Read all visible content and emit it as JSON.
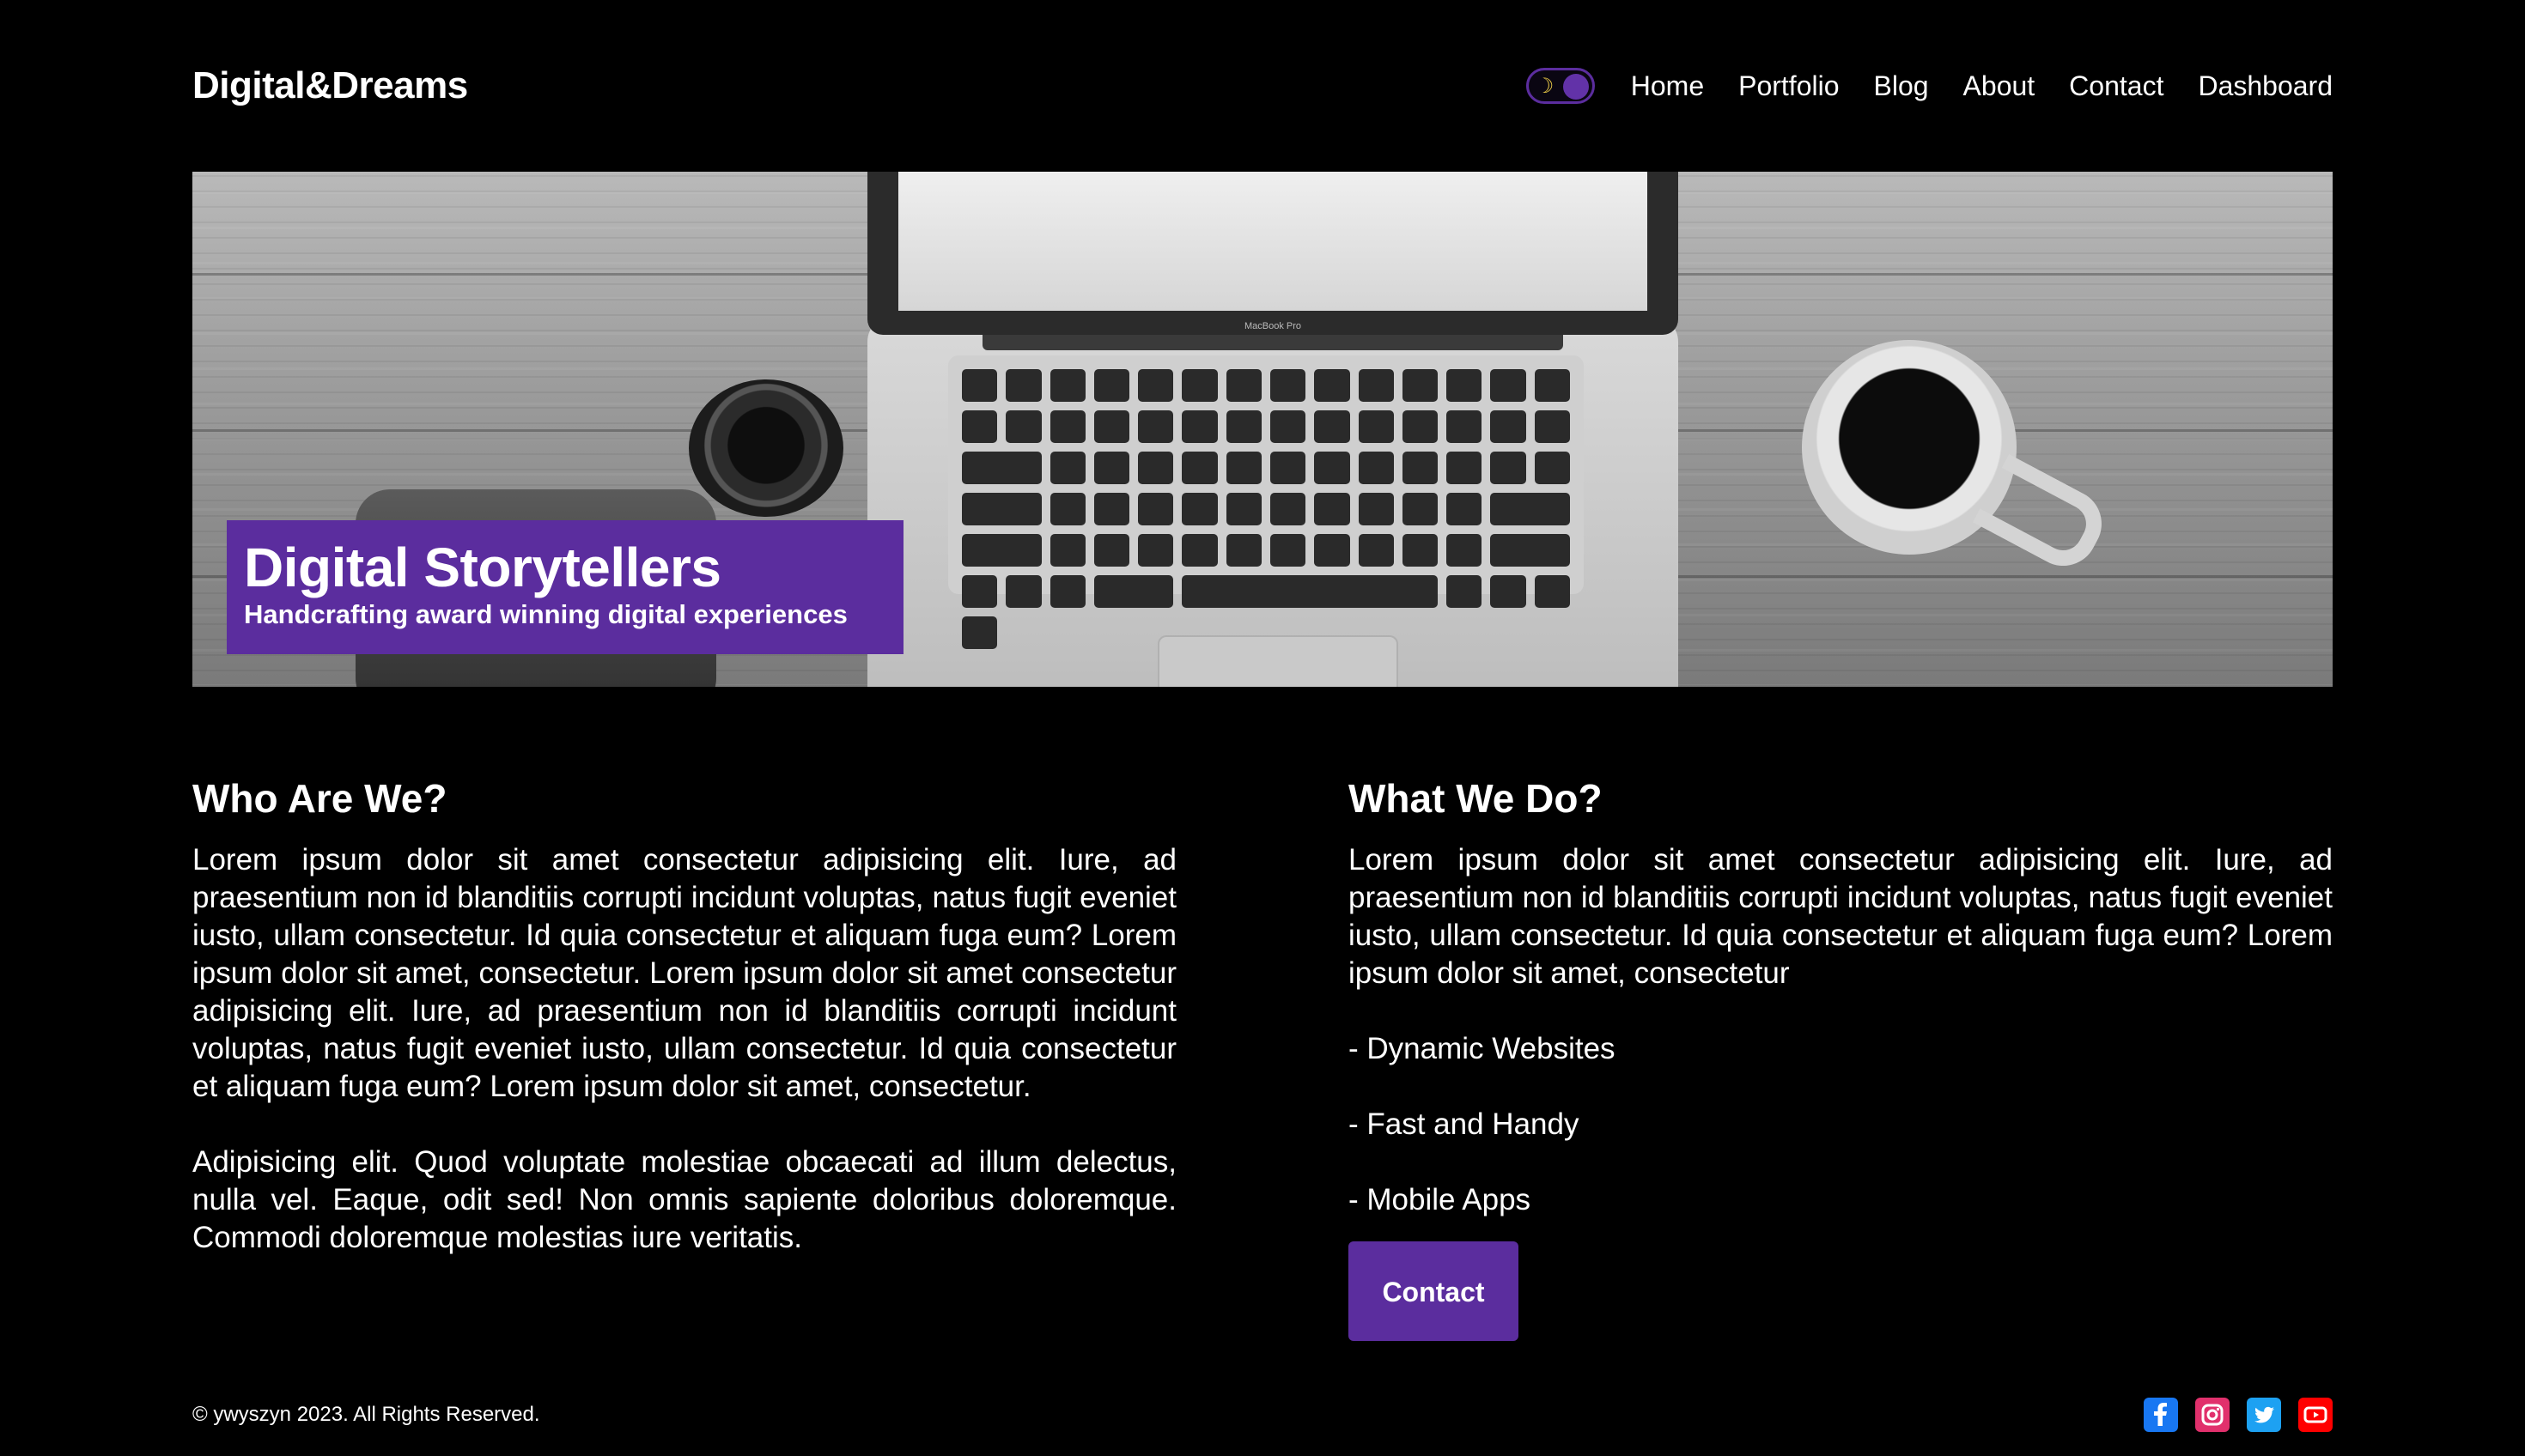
{
  "header": {
    "logo": "Digital&Dreams",
    "theme_toggle_icon": "crescent-moon-icon",
    "nav": [
      "Home",
      "Portfolio",
      "Blog",
      "About",
      "Contact",
      "Dashboard"
    ]
  },
  "hero": {
    "title": "Digital Storytellers",
    "subtitle": "Handcrafting award winning digital experiences",
    "laptop_label": "MacBook Pro"
  },
  "who": {
    "heading": "Who Are We?",
    "paragraphs": [
      "Lorem ipsum dolor sit amet consectetur adipisicing elit. Iure, ad praesentium non id blanditiis corrupti incidunt voluptas, natus fugit eveniet iusto, ullam consectetur. Id quia consectetur et aliquam fuga eum? Lorem ipsum dolor sit amet, consectetur. Lorem ipsum dolor sit amet consectetur adipisicing elit. Iure, ad praesentium non id blanditiis corrupti incidunt voluptas, natus fugit eveniet iusto, ullam consectetur. Id quia consectetur et aliquam fuga eum? Lorem ipsum dolor sit amet, consectetur.",
      "Adipisicing elit. Quod voluptate molestiae obcaecati ad illum delectus, nulla vel. Eaque, odit sed! Non omnis sapiente doloribus doloremque. Commodi doloremque molestias iure veritatis."
    ]
  },
  "what": {
    "heading": "What We Do?",
    "intro": "Lorem ipsum dolor sit amet consectetur adipisicing elit. Iure, ad praesentium non id blanditiis corrupti incidunt voluptas, natus fugit eveniet iusto, ullam consectetur. Id quia consectetur et aliquam fuga eum? Lorem ipsum dolor sit amet, consectetur",
    "services": [
      "- Dynamic Websites",
      "- Fast and Handy",
      "- Mobile Apps"
    ],
    "cta": "Contact"
  },
  "footer": {
    "copyright": "© ywyszyn 2023. All Rights Reserved.",
    "socials": [
      {
        "icon": "facebook-icon",
        "color": "#1877f2"
      },
      {
        "icon": "instagram-icon",
        "color": "#e1306c"
      },
      {
        "icon": "twitter-icon",
        "color": "#1da1f2"
      },
      {
        "icon": "youtube-icon",
        "color": "#ff0000"
      }
    ]
  },
  "colors": {
    "accent": "#5b2d9e",
    "background": "#000000",
    "text": "#ffffff"
  }
}
